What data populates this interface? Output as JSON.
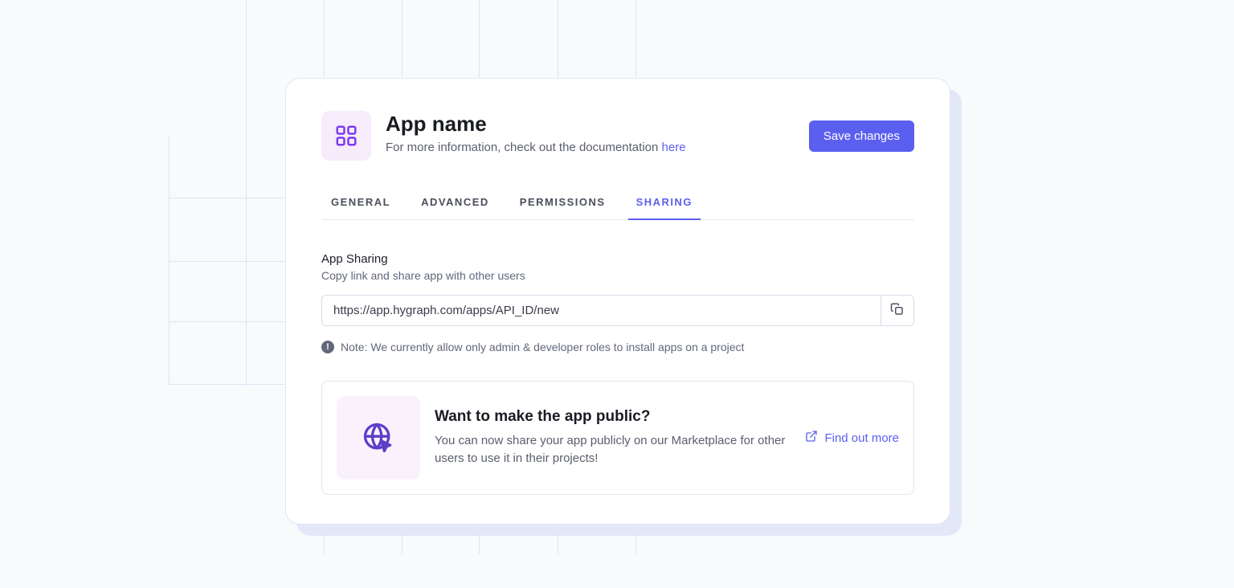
{
  "header": {
    "title": "App name",
    "subtitle_prefix": "For more information, check out the documentation ",
    "subtitle_link": "here",
    "save_label": "Save changes"
  },
  "tabs": {
    "general": "General",
    "advanced": "Advanced",
    "permissions": "Permissions",
    "sharing": "Sharing"
  },
  "sharing": {
    "title": "App Sharing",
    "subtitle": "Copy link and share app with other users",
    "url": "https://app.hygraph.com/apps/API_ID/new",
    "note": "Note: We currently allow only admin & developer roles to install apps on a project"
  },
  "promo": {
    "title": "Want to make the app public?",
    "body": "You can now share your app publicly on our Marketplace for other users to use it in their projects!",
    "cta": "Find out more"
  }
}
